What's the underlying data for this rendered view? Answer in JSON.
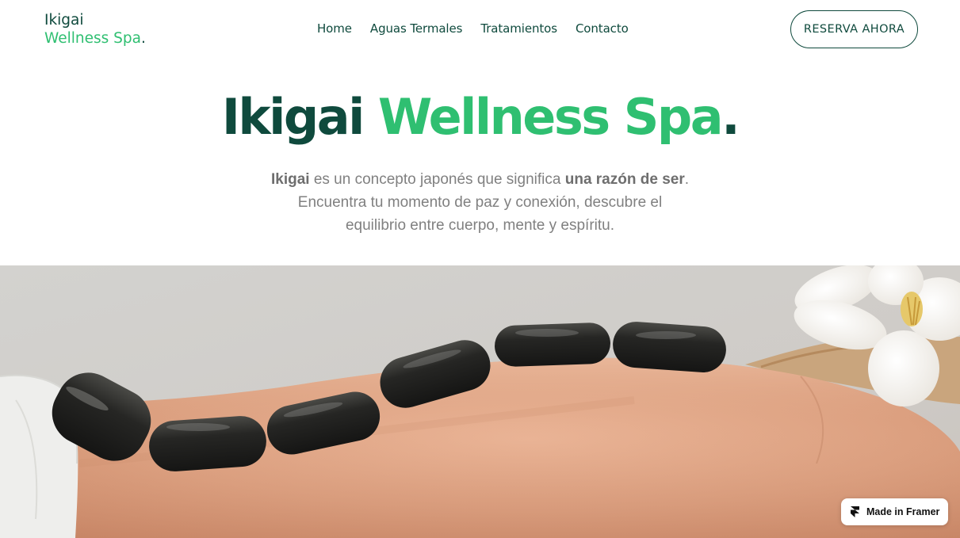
{
  "header": {
    "logo_line1": "Ikigai",
    "logo_line2": "Wellness Spa",
    "logo_dot": ".",
    "nav": [
      "Home",
      "Aguas Termales",
      "Tratamientos",
      "Contacto"
    ],
    "cta_label": "RESERVA AHORA"
  },
  "hero": {
    "title_part1": "Ikigai ",
    "title_part2": "Wellness Spa",
    "title_dot": ".",
    "sub_bold1": "Ikigai",
    "sub_text1": " es un concepto japonés que significa ",
    "sub_bold2": "una razón de ser",
    "sub_text2": ".",
    "sub_line2": "Encuentra tu momento de paz y conexión, descubre el",
    "sub_line3": "equilibrio entre cuerpo, mente y espíritu."
  },
  "badge": {
    "label": "Made in Framer",
    "icon": "framer-icon"
  },
  "colors": {
    "brand_dark": "#0f4a3d",
    "brand_green": "#2fbf71",
    "muted_text": "#808080"
  }
}
